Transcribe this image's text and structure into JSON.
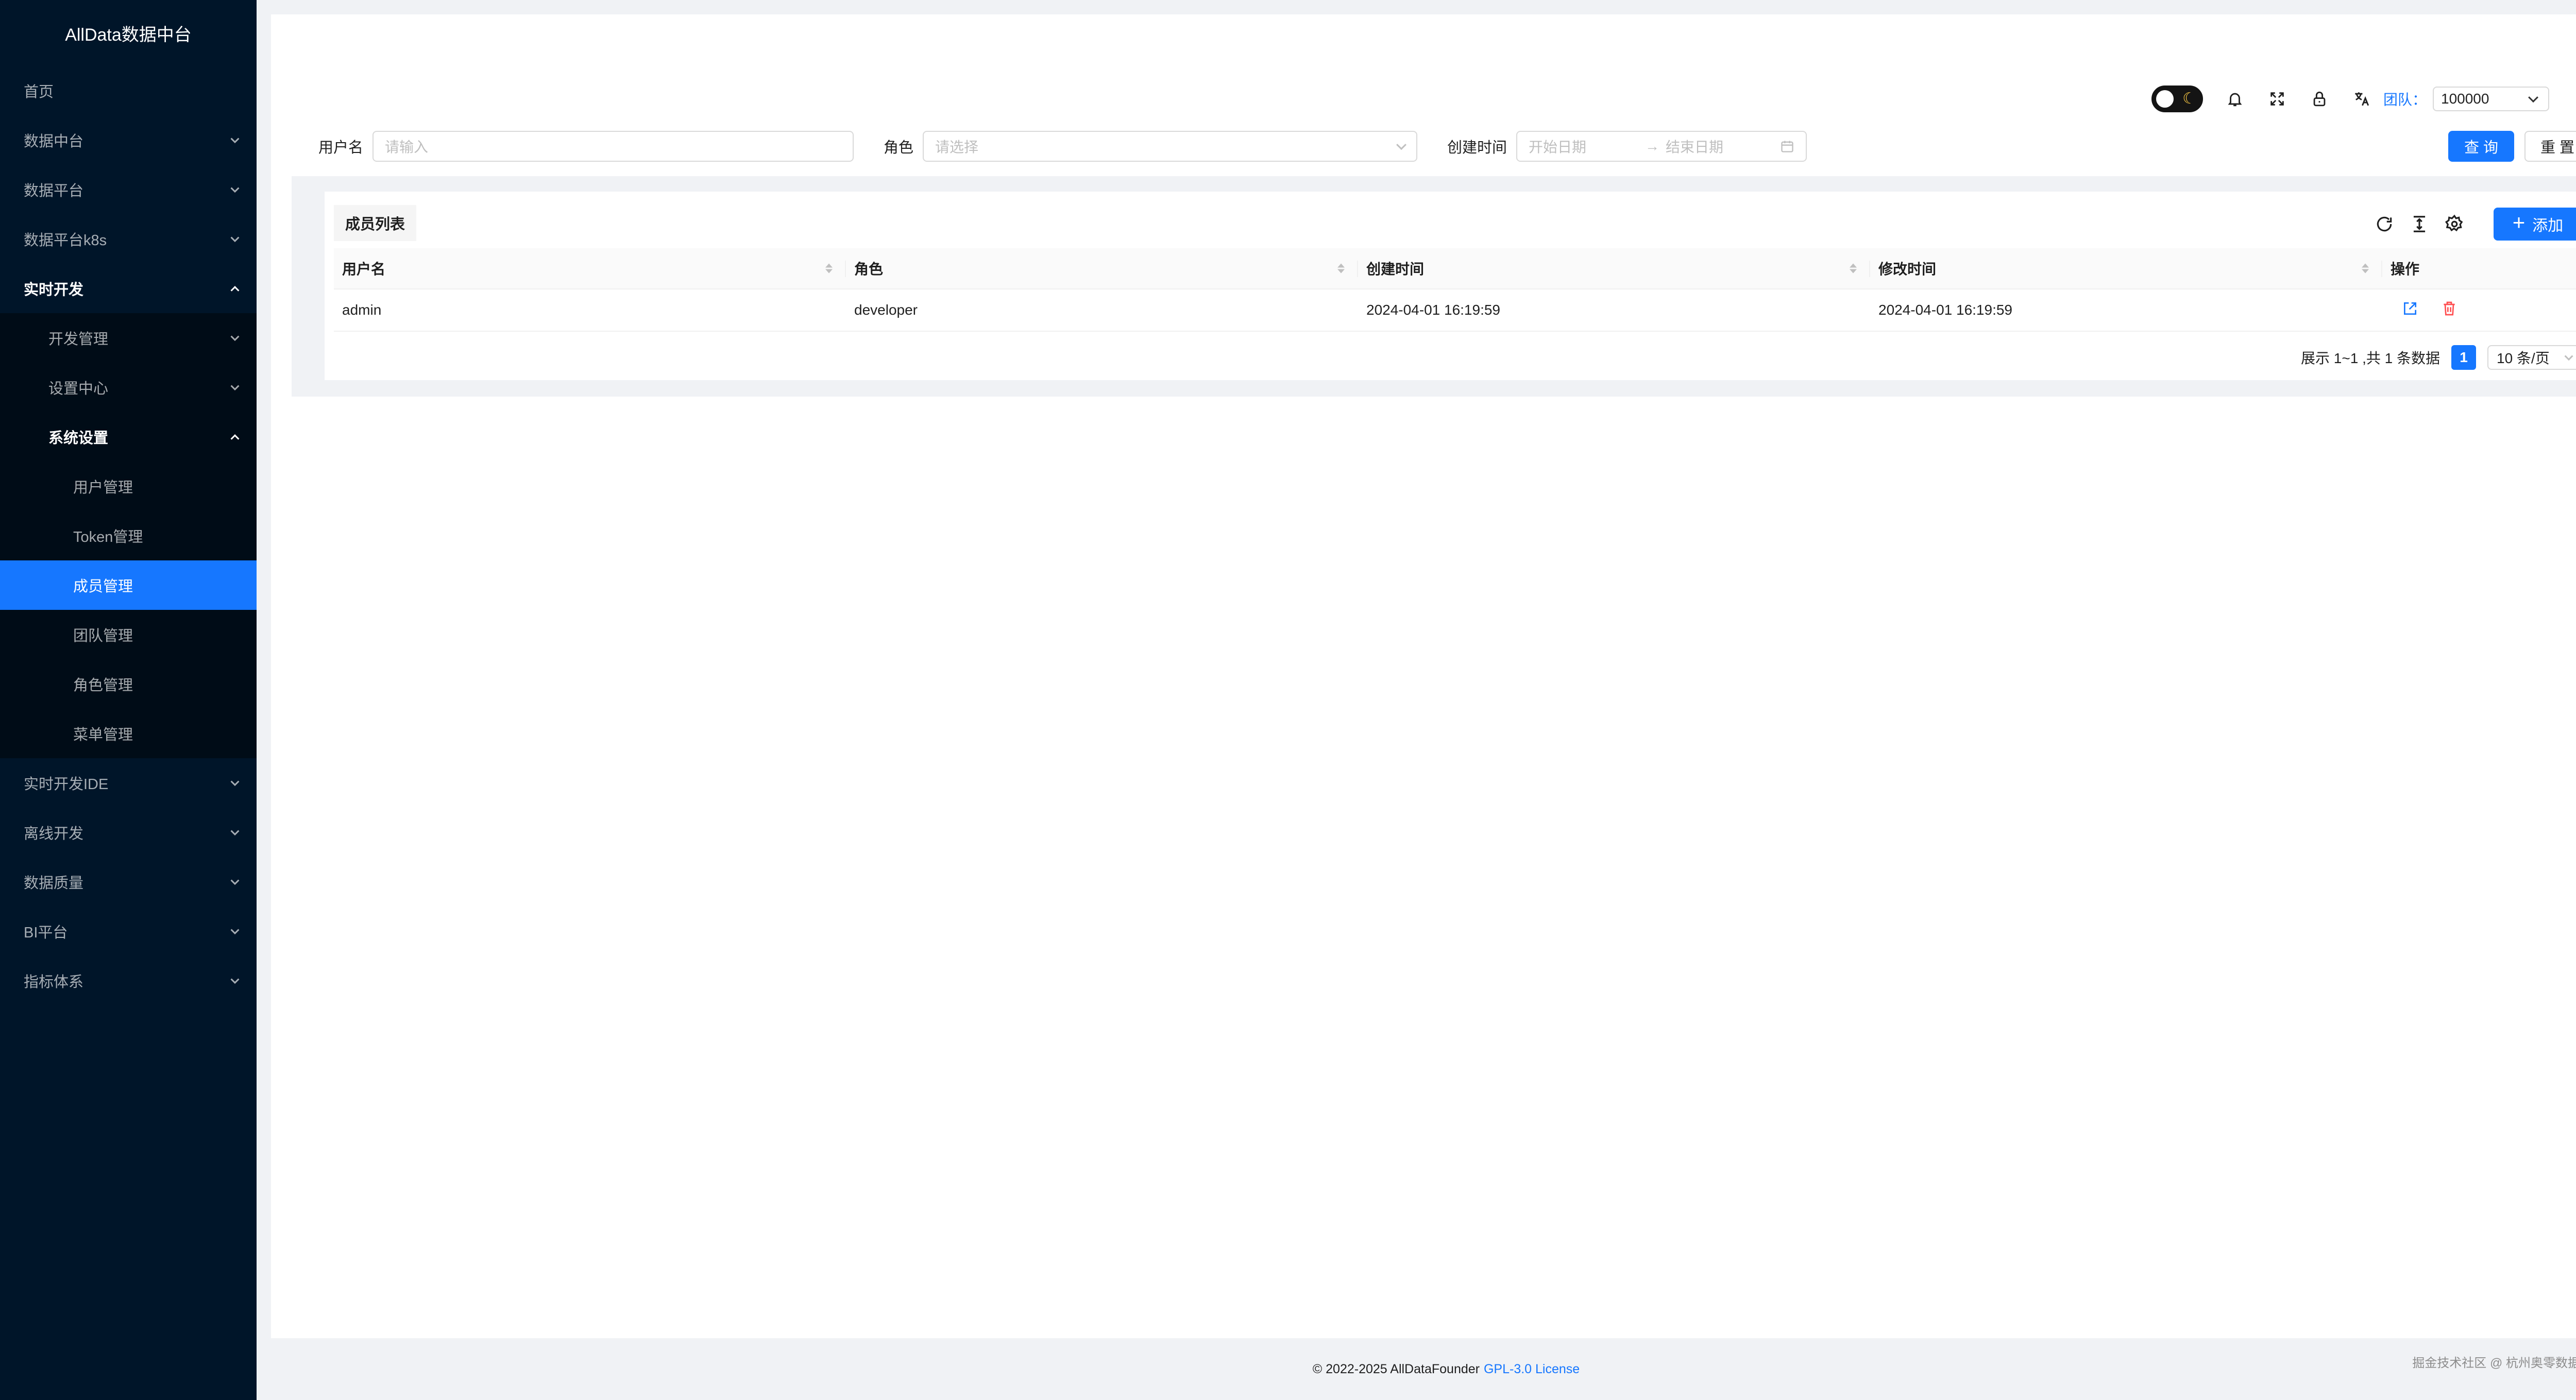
{
  "app": {
    "title": "AllData数据中台"
  },
  "colors": {
    "sidebar_bg": "#001529",
    "accent": "#1677ff",
    "danger": "#ff4d4f"
  },
  "sidebar": {
    "items": [
      {
        "label": "首页",
        "level": 1,
        "expandable": false
      },
      {
        "label": "数据中台",
        "level": 1,
        "expandable": true,
        "expanded": false
      },
      {
        "label": "数据平台",
        "level": 1,
        "expandable": true,
        "expanded": false
      },
      {
        "label": "数据平台k8s",
        "level": 1,
        "expandable": true,
        "expanded": false
      },
      {
        "label": "实时开发",
        "level": 1,
        "expandable": true,
        "expanded": true
      },
      {
        "label": "开发管理",
        "level": 2,
        "expandable": true,
        "expanded": false
      },
      {
        "label": "设置中心",
        "level": 2,
        "expandable": true,
        "expanded": false
      },
      {
        "label": "系统设置",
        "level": 2,
        "expandable": true,
        "expanded": true
      },
      {
        "label": "用户管理",
        "level": 3
      },
      {
        "label": "Token管理",
        "level": 3
      },
      {
        "label": "成员管理",
        "level": 3,
        "active": true
      },
      {
        "label": "团队管理",
        "level": 3
      },
      {
        "label": "角色管理",
        "level": 3
      },
      {
        "label": "菜单管理",
        "level": 3
      },
      {
        "label": "实时开发IDE",
        "level": 1,
        "expandable": true,
        "expanded": false
      },
      {
        "label": "离线开发",
        "level": 1,
        "expandable": true,
        "expanded": false
      },
      {
        "label": "数据质量",
        "level": 1,
        "expandable": true,
        "expanded": false
      },
      {
        "label": "BI平台",
        "level": 1,
        "expandable": true,
        "expanded": false
      },
      {
        "label": "指标体系",
        "level": 1,
        "expandable": true,
        "expanded": false
      }
    ]
  },
  "header": {
    "theme_toggle_icon": "moon-icon",
    "icons": [
      "bell-icon",
      "fullscreen-icon",
      "lock-icon",
      "translate-icon"
    ],
    "team_label": "团队：",
    "team_value": "100000"
  },
  "search": {
    "username_label": "用户名",
    "username_placeholder": "请输入",
    "role_label": "角色",
    "role_placeholder": "请选择",
    "created_label": "创建时间",
    "start_placeholder": "开始日期",
    "end_placeholder": "结束日期",
    "query_button": "查 询",
    "reset_button": "重 置"
  },
  "table": {
    "title": "成员列表",
    "add_button": "添加",
    "columns": [
      "用户名",
      "角色",
      "创建时间",
      "修改时间",
      "操作"
    ],
    "rows": [
      {
        "username": "admin",
        "role": "developer",
        "created": "2024-04-01 16:19:59",
        "modified": "2024-04-01 16:19:59"
      }
    ],
    "pagination": {
      "summary": "展示 1~1 ,共 1 条数据",
      "current_page": "1",
      "page_size": "10 条/页"
    }
  },
  "footer": {
    "copyright": "© 2022-2025 AllDataFounder",
    "license": "GPL-3.0 License",
    "watermark": "掘金技术社区 @ 杭州奥零数据科技"
  }
}
